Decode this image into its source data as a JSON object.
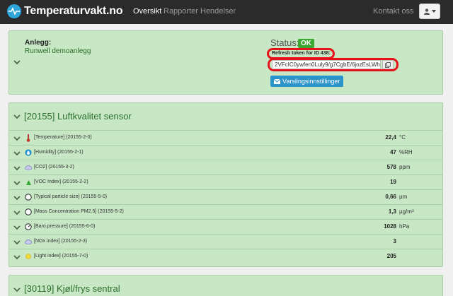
{
  "navbar": {
    "brand": "Temperaturvakt.no",
    "links": {
      "oversikt": "Oversikt",
      "rapporter": "Rapporter",
      "hendelser": "Hendelser",
      "kontakt": "Kontakt oss"
    }
  },
  "facility": {
    "label": "Anlegg:",
    "name": "Runwell demoanlegg",
    "status_label": "Status:",
    "status_value": "OK",
    "token_label": "Refresh token for ID 438:",
    "token_value": "2VFcIC0ywfen0Luly9/g7CgbE/6jozEsLWh",
    "notify_button": "Varslingsinnstillinger"
  },
  "sensor1": {
    "title": "[20155] Luftkvalitet sensor",
    "rows": [
      {
        "icon": "thermometer-icon",
        "label": "[Temperature] (20155-2-0)",
        "value": "22,4",
        "unit": "°C"
      },
      {
        "icon": "drop-icon",
        "label": "[Humidity] (20155-2-1)",
        "value": "47",
        "unit": "%RH"
      },
      {
        "icon": "cloud-icon",
        "label": "[CO2] (20155-3-2)",
        "value": "578",
        "unit": "ppm"
      },
      {
        "icon": "leaf-icon",
        "label": "[VOC Index] (20155-2-2)",
        "value": "19",
        "unit": ""
      },
      {
        "icon": "circle-icon",
        "label": "[Typical particle size] (20155-5-0)",
        "value": "0,66",
        "unit": "µm"
      },
      {
        "icon": "circle-icon",
        "label": "[Mass Concentration PM2.5] (20155-5-2)",
        "value": "1,3",
        "unit": "µg/m³"
      },
      {
        "icon": "gauge-icon",
        "label": "[Baro.pressure] (20155-6-0)",
        "value": "1028",
        "unit": "hPa"
      },
      {
        "icon": "cloud-icon",
        "label": "[NOx index] (20155-2-3)",
        "value": "3",
        "unit": ""
      },
      {
        "icon": "sun-icon",
        "label": "[Light index] (20155-7-0)",
        "value": "205",
        "unit": ""
      }
    ]
  },
  "sensor2": {
    "title": "[30119] Kjøl/frys sentral"
  }
}
